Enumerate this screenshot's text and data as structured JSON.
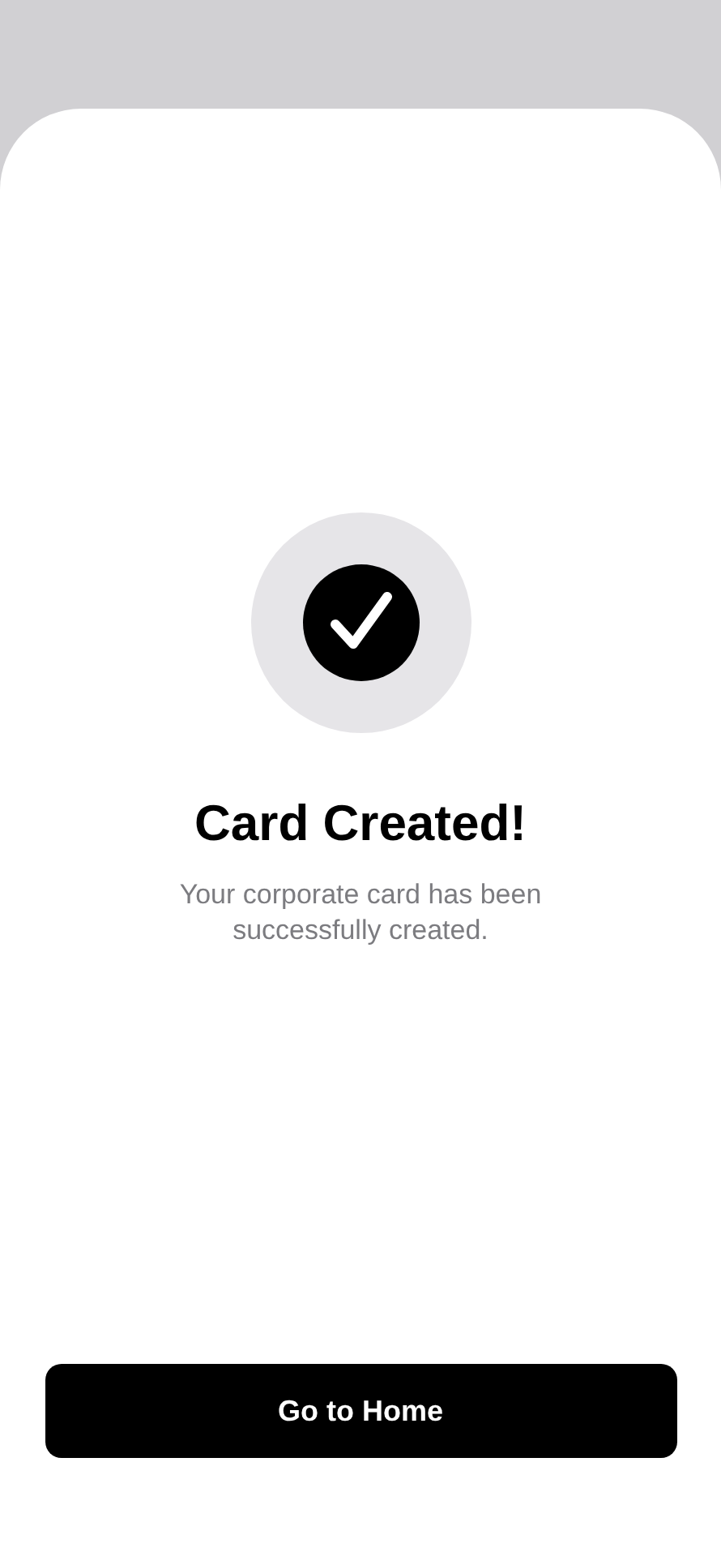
{
  "sheet": {
    "title": "Card Created!",
    "message": "Your corporate card has been successfully created."
  },
  "button": {
    "label": "Go to Home"
  }
}
